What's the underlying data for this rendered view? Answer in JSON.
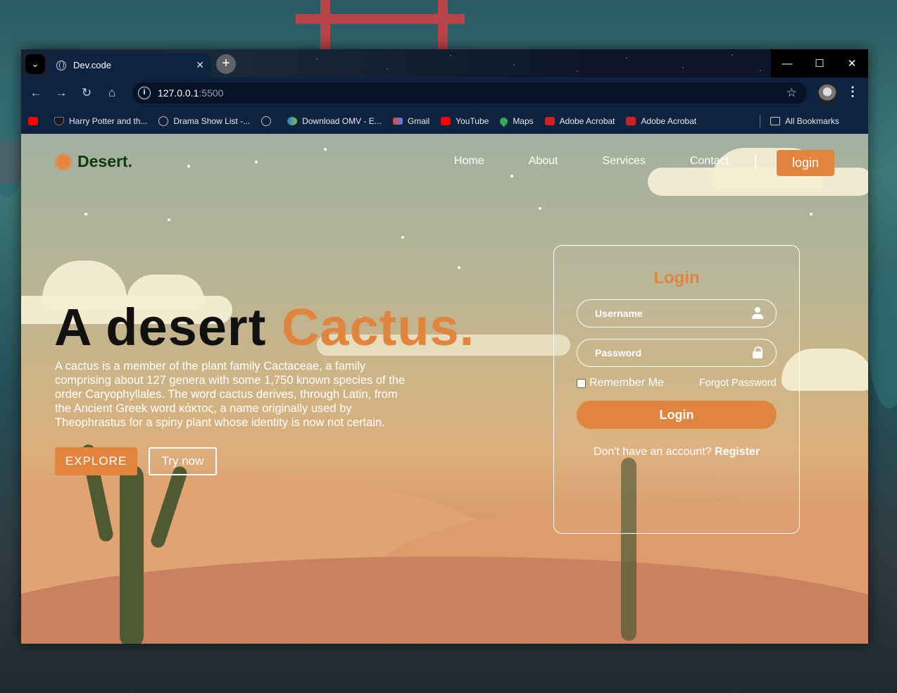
{
  "browser": {
    "tab_title": "Dev.code",
    "url_host": "127.0.0.1",
    "url_port": ":5500",
    "bookmarks": [
      {
        "label": "",
        "icon": "youtube-icon"
      },
      {
        "label": "Harry Potter and th...",
        "icon": "shield-icon"
      },
      {
        "label": "Drama Show List -...",
        "icon": "globe-icon"
      },
      {
        "label": "",
        "icon": "globe-icon"
      },
      {
        "label": "Download OMV - E...",
        "icon": "omv-icon"
      },
      {
        "label": "Gmail",
        "icon": "gmail-icon"
      },
      {
        "label": "YouTube",
        "icon": "youtube-icon"
      },
      {
        "label": "Maps",
        "icon": "maps-icon"
      },
      {
        "label": "Adobe Acrobat",
        "icon": "acrobat-icon"
      },
      {
        "label": "Adobe Acrobat",
        "icon": "acrobat-icon"
      }
    ],
    "all_bookmarks": "All Bookmarks"
  },
  "site": {
    "brand": "Desert.",
    "nav": [
      "Home",
      "About",
      "Services",
      "Contact"
    ],
    "login_button": "login",
    "hero": {
      "title_main": "A desert ",
      "title_accent": "Cactus.",
      "text": "A cactus is a member of the plant family Cactaceae, a family comprising about 127 genera with some 1,750 known species of the order Caryophyllales. The word cactus derives, through Latin, from the Ancient Greek word κάκτος, a name originally used by Theophrastus for a spiny plant whose identity is now not certain.",
      "explore": "EXPLORE",
      "try_now": "Try now"
    },
    "login_form": {
      "title": "Login",
      "username_placeholder": "Username",
      "password_placeholder": "Password",
      "remember": "Remember Me",
      "forgot": "Forgot Password",
      "submit": "Login",
      "no_account": "Don't have an account? ",
      "register": "Register"
    }
  },
  "colors": {
    "accent": "#e1843e",
    "brand_text": "#0f3a0f",
    "tab_bg": "#0e2340"
  }
}
